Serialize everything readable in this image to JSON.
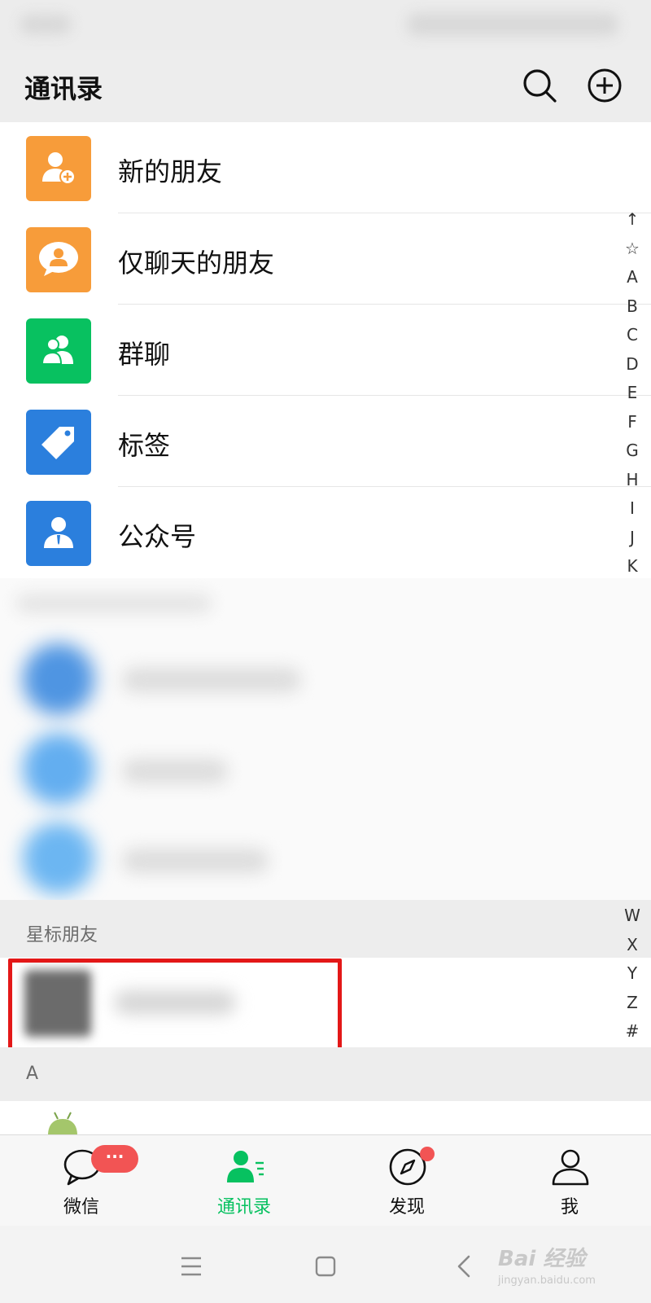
{
  "header": {
    "title": "通讯录"
  },
  "function_items": [
    {
      "label": "新的朋友",
      "icon": "add-friend-icon",
      "color": "#f79c3a"
    },
    {
      "label": "仅聊天的朋友",
      "icon": "chat-only-icon",
      "color": "#f79c3a"
    },
    {
      "label": "群聊",
      "icon": "group-chat-icon",
      "color": "#08c160"
    },
    {
      "label": "标签",
      "icon": "tag-icon",
      "color": "#2b7fdd"
    },
    {
      "label": "公众号",
      "icon": "official-account-icon",
      "color": "#2b7fdd"
    }
  ],
  "sections": {
    "starred": "星标朋友",
    "a": "A"
  },
  "alpha_index_top": [
    "↑",
    "☆",
    "A",
    "B",
    "C",
    "D",
    "E",
    "F",
    "G",
    "H",
    "I",
    "J",
    "K"
  ],
  "alpha_index_bottom": [
    "W",
    "X",
    "Y",
    "Z",
    "#"
  ],
  "tabs": [
    {
      "label": "微信",
      "icon": "chat-bubble-icon",
      "badge": "···",
      "active": false
    },
    {
      "label": "通讯录",
      "icon": "contacts-icon",
      "active": true
    },
    {
      "label": "发现",
      "icon": "compass-icon",
      "dot": true,
      "active": false
    },
    {
      "label": "我",
      "icon": "person-icon",
      "active": false
    }
  ],
  "colors": {
    "accent": "#07c160",
    "badge": "#f25454",
    "highlight": "#e31818"
  },
  "watermark": {
    "text": "Bai 经验",
    "sub": "jingyan.baidu.com"
  }
}
